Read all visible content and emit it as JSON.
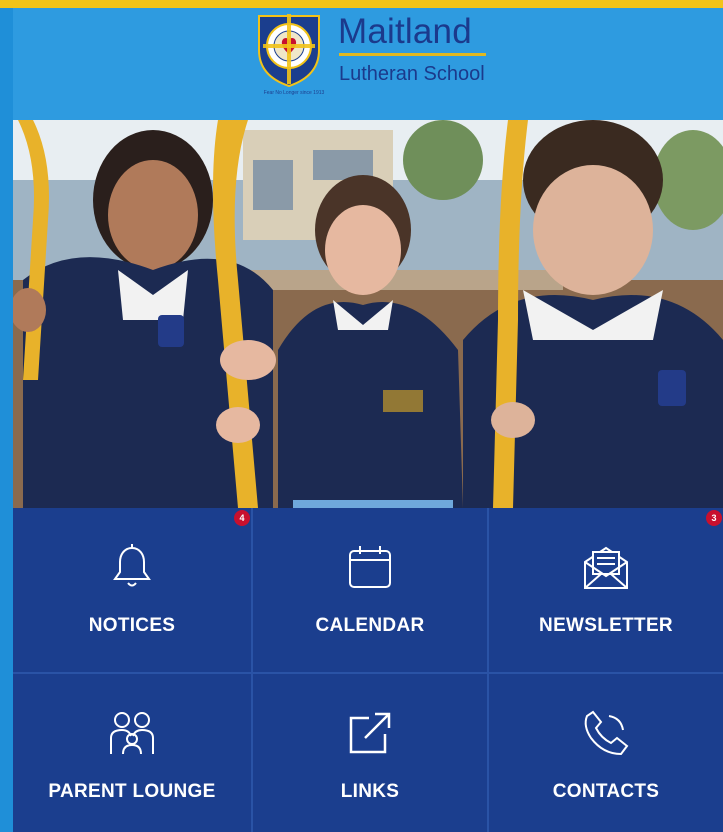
{
  "header": {
    "brand_name": "Maitland",
    "brand_sub": "Lutheran School",
    "motto": "Fear No Longer since 1913"
  },
  "photo": {
    "icon": "hero-photo-students"
  },
  "tiles": [
    {
      "label": "NOTICES",
      "icon": "bell-icon",
      "badge": "4"
    },
    {
      "label": "CALENDAR",
      "icon": "calendar-icon",
      "badge": ""
    },
    {
      "label": "NEWSLETTER",
      "icon": "envelope-newsletter-icon",
      "badge": "3"
    },
    {
      "label": "PARENT LOUNGE",
      "icon": "family-icon",
      "badge": ""
    },
    {
      "label": "LINKS",
      "icon": "external-link-icon",
      "badge": ""
    },
    {
      "label": "CONTACTS",
      "icon": "phone-icon",
      "badge": ""
    }
  ],
  "colors": {
    "header_bg": "#2e9be0",
    "accent": "#f2c318",
    "tile_bg": "#1b3e8e",
    "badge": "#c8102e",
    "brand_text": "#1b3a8c"
  }
}
